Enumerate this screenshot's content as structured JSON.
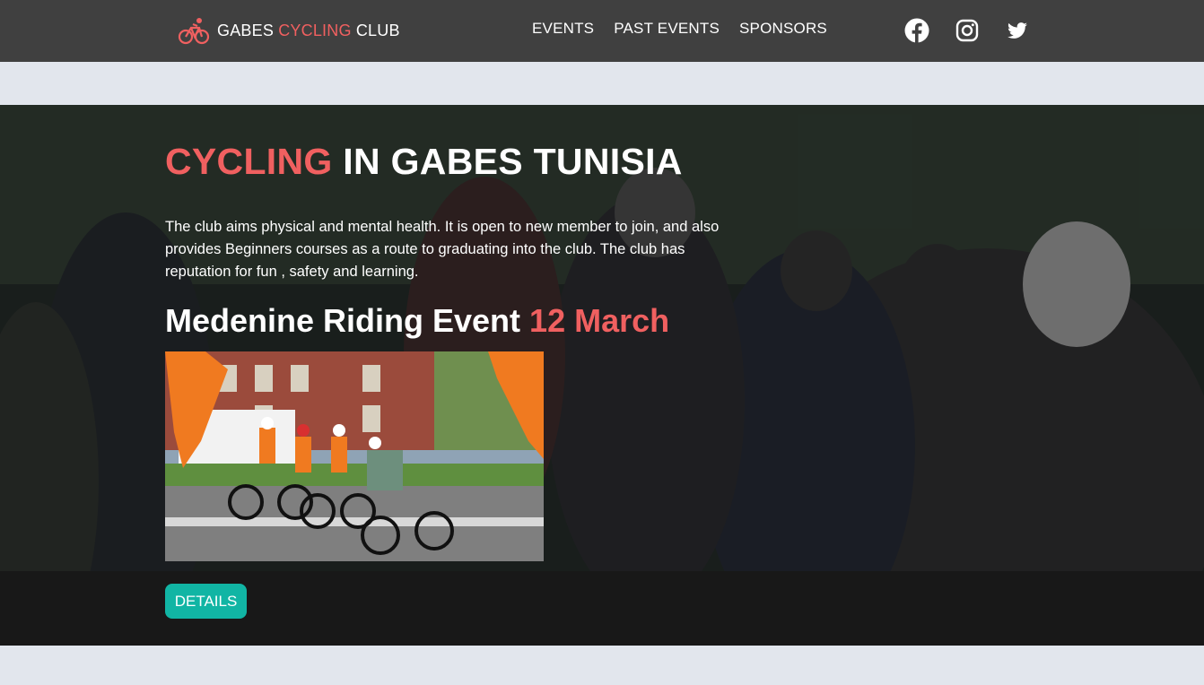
{
  "header": {
    "brand_part1": "GABES ",
    "brand_accent": "CYCLING",
    "brand_part2": " CLUB",
    "logo_icon": "bicycle-rider-icon",
    "nav": [
      {
        "label": "EVENTS"
      },
      {
        "label": "PAST EVENTS"
      },
      {
        "label": "SPONSORS"
      }
    ],
    "social": [
      {
        "name": "facebook-icon"
      },
      {
        "name": "instagram-icon"
      },
      {
        "name": "twitter-icon"
      }
    ]
  },
  "hero": {
    "title_accent": "CYCLING",
    "title_rest": " IN GABES TUNISIA",
    "description": "The club aims physical and mental health. It is open to new member to join, and also provides Beginners courses as a route to graduating into the club. The club has reputation for fun , safety and learning.",
    "event_name": "Medenine Riding Event ",
    "event_date": "12 March",
    "details_label": "DETAILS"
  },
  "colors": {
    "accent": "#f06060",
    "button": "#11b5a4",
    "topbar": "#404040",
    "page_bg": "#e2e6ed"
  }
}
